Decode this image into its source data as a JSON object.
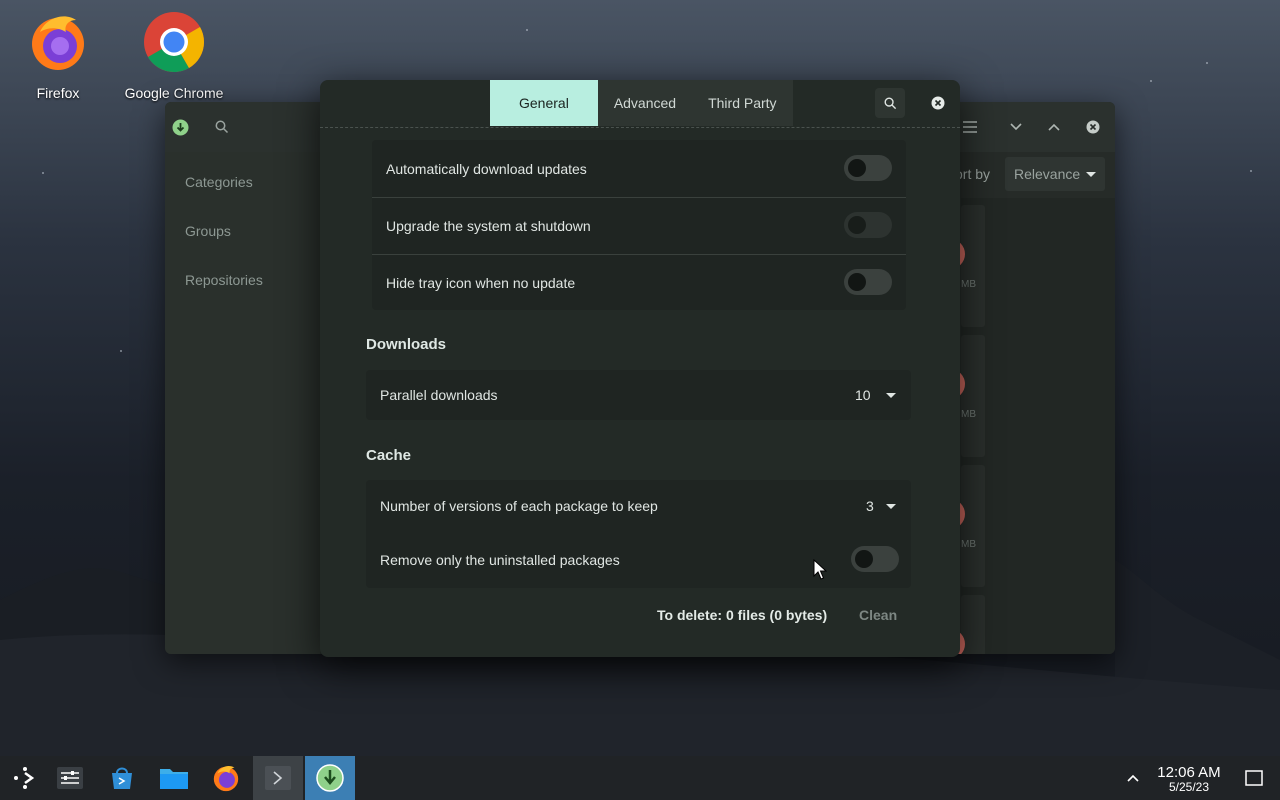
{
  "desktop": {
    "icons": [
      {
        "label": "Firefox"
      },
      {
        "label": "Google Chrome"
      }
    ]
  },
  "background_window": {
    "sidebar": [
      "Categories",
      "Groups",
      "Repositories"
    ],
    "sort_label": "ort by",
    "sort_value": "Relevance",
    "card_sizes": [
      "MB",
      "MB",
      "MB"
    ]
  },
  "dialog": {
    "tabs": [
      {
        "label": "General",
        "active": true
      },
      {
        "label": "Advanced",
        "active": false
      },
      {
        "label": "Third Party",
        "active": false
      }
    ],
    "updates": [
      {
        "label": "Automatically download updates",
        "enabled": false
      },
      {
        "label": "Upgrade the system at shutdown",
        "enabled": false,
        "disabled": true
      },
      {
        "label": "Hide tray icon when no update",
        "enabled": false
      }
    ],
    "downloads": {
      "title": "Downloads",
      "parallel_label": "Parallel downloads",
      "parallel_value": "10"
    },
    "cache": {
      "title": "Cache",
      "versions_label": "Number of versions of each package to keep",
      "versions_value": "3",
      "remove_label": "Remove only the uninstalled packages",
      "remove_enabled": false
    },
    "footer": {
      "to_delete": "To delete:  0 files  (0 bytes)",
      "clean": "Clean"
    }
  },
  "taskbar": {
    "time": "12:06 AM",
    "date": "5/25/23"
  },
  "colors": {
    "accent": "#b8eee0",
    "taskbar_active": "#3c7fb4"
  }
}
